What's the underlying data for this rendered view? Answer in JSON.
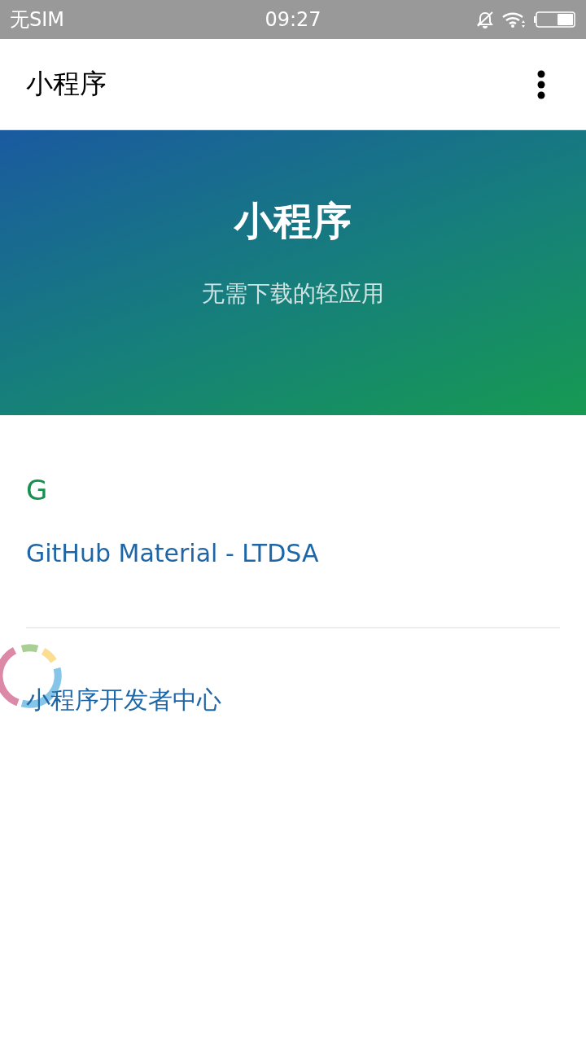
{
  "status_bar": {
    "carrier": "无SIM",
    "time": "09:27"
  },
  "app_bar": {
    "title": "小程序"
  },
  "hero": {
    "title": "小程序",
    "subtitle": "无需下载的轻应用"
  },
  "sections": [
    {
      "letter": "G",
      "links": [
        "GitHub Material - LTDSA"
      ]
    },
    {
      "links": [
        "小程序开发者中心"
      ]
    }
  ],
  "loading": true
}
